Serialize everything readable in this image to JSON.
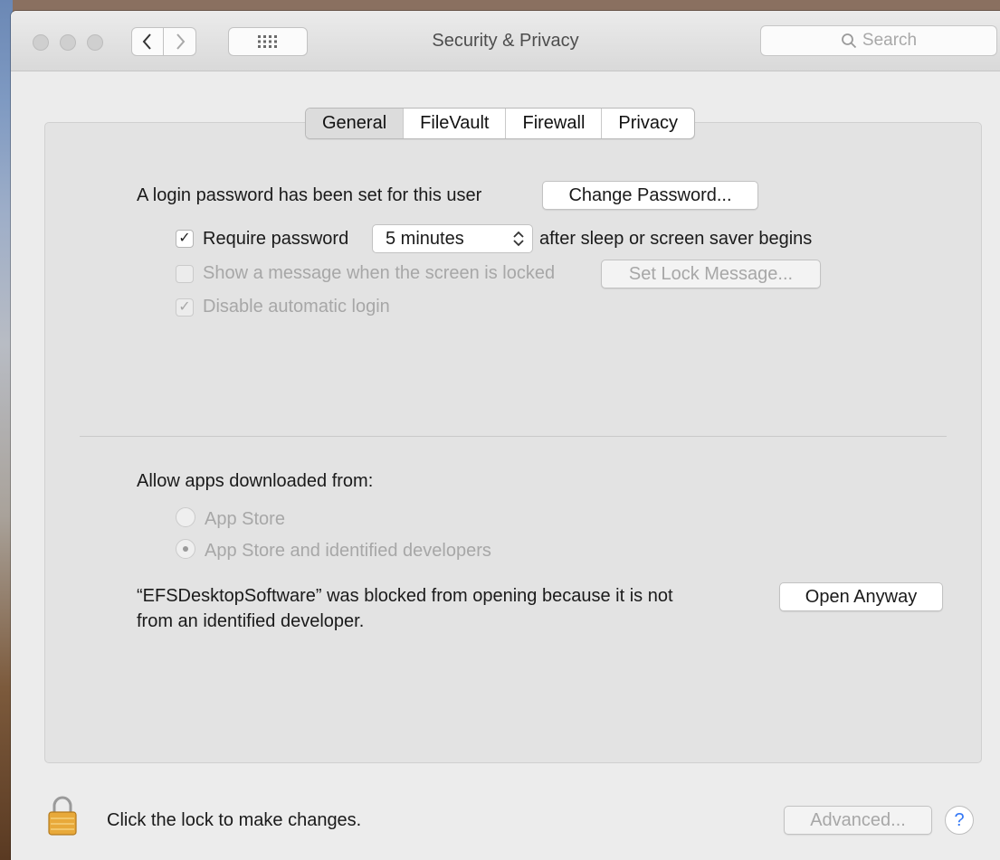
{
  "window": {
    "title": "Security & Privacy"
  },
  "search": {
    "placeholder": "Search"
  },
  "tabs": [
    {
      "label": "General",
      "selected": true
    },
    {
      "label": "FileVault",
      "selected": false
    },
    {
      "label": "Firewall",
      "selected": false
    },
    {
      "label": "Privacy",
      "selected": false
    }
  ],
  "general": {
    "login_text": "A login password has been set for this user",
    "change_password_label": "Change Password...",
    "require_password": {
      "label": "Require password",
      "checked": true,
      "check_glyph": "✓"
    },
    "require_interval": "5 minutes",
    "require_suffix": "after sleep or screen saver begins",
    "show_message": {
      "label": "Show a message when the screen is locked",
      "checked": false,
      "enabled": false
    },
    "set_lock_message_label": "Set Lock Message...",
    "disable_auto_login": {
      "label": "Disable automatic login",
      "checked": true,
      "enabled": false,
      "check_glyph": "✓"
    },
    "allow_apps_label": "Allow apps downloaded from:",
    "radio_app_store": {
      "label": "App Store",
      "selected": false
    },
    "radio_identified": {
      "label": "App Store and identified developers",
      "selected": true
    },
    "blocked_line1": "“EFSDesktopSoftware” was blocked from opening because it is not",
    "blocked_line2": "from an identified developer.",
    "open_anyway_label": "Open Anyway"
  },
  "footer": {
    "lock_text": "Click the lock to make changes.",
    "advanced_label": "Advanced...",
    "help_label": "?"
  },
  "icons": [
    "back-chevron-icon",
    "forward-chevron-icon",
    "grid-icon",
    "search-icon",
    "lock-icon",
    "help-icon"
  ],
  "colors": {
    "accent": "#3478f6",
    "window_bg": "#ececec",
    "panel_bg": "#e3e3e3"
  }
}
